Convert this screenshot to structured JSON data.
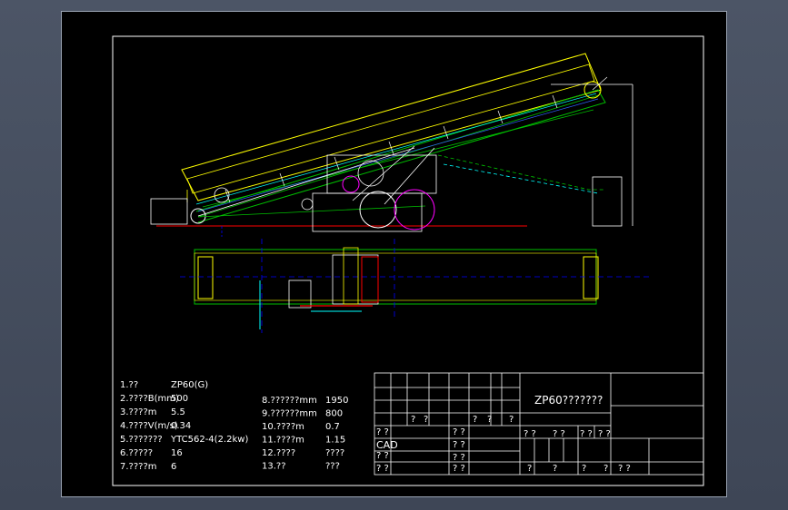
{
  "specs_left": [
    {
      "label": "1.??",
      "value": "ZP60(G)"
    },
    {
      "label": "2.????B(mm)",
      "value": "500"
    },
    {
      "label": "3.????m",
      "value": "5.5"
    },
    {
      "label": "4.????V(m/s)",
      "value": "0.34"
    },
    {
      "label": "5.???????",
      "value": "YTC562-4(2.2kw)"
    },
    {
      "label": "6.?????",
      "value": "16"
    },
    {
      "label": "7.????m",
      "value": "6"
    }
  ],
  "specs_right": [
    {
      "label": "8.??????mm",
      "value": "1950"
    },
    {
      "label": "9.??????mm",
      "value": "800"
    },
    {
      "label": "10.????m",
      "value": "0.7"
    },
    {
      "label": "11.????m",
      "value": "1.15"
    },
    {
      "label": "12.????",
      "value": "????"
    },
    {
      "label": "13.??",
      "value": "???"
    }
  ],
  "title_block": {
    "title": "ZP60???????",
    "cad": "CAD",
    "row_a": [
      "? ?",
      "?",
      "?",
      "? ?",
      "?",
      "?",
      "?"
    ],
    "row_b": [
      "? ?",
      "? ?",
      "? ?",
      "? ?"
    ],
    "row_c": [
      "? ?",
      "? ?"
    ],
    "row_d": [
      "? ?",
      "? ?"
    ],
    "row_e": [
      "?",
      "?",
      "?",
      "?"
    ],
    "row_f": [
      "? ?",
      "? ?"
    ]
  },
  "colors": {
    "sheet": "#000000",
    "line": "#ffffff",
    "belt": "#ffff00",
    "frame": "#00c000",
    "axis": "#0000ff",
    "pulley": "#ff00ff",
    "base": "#ff0000",
    "center": "#00ffff"
  }
}
